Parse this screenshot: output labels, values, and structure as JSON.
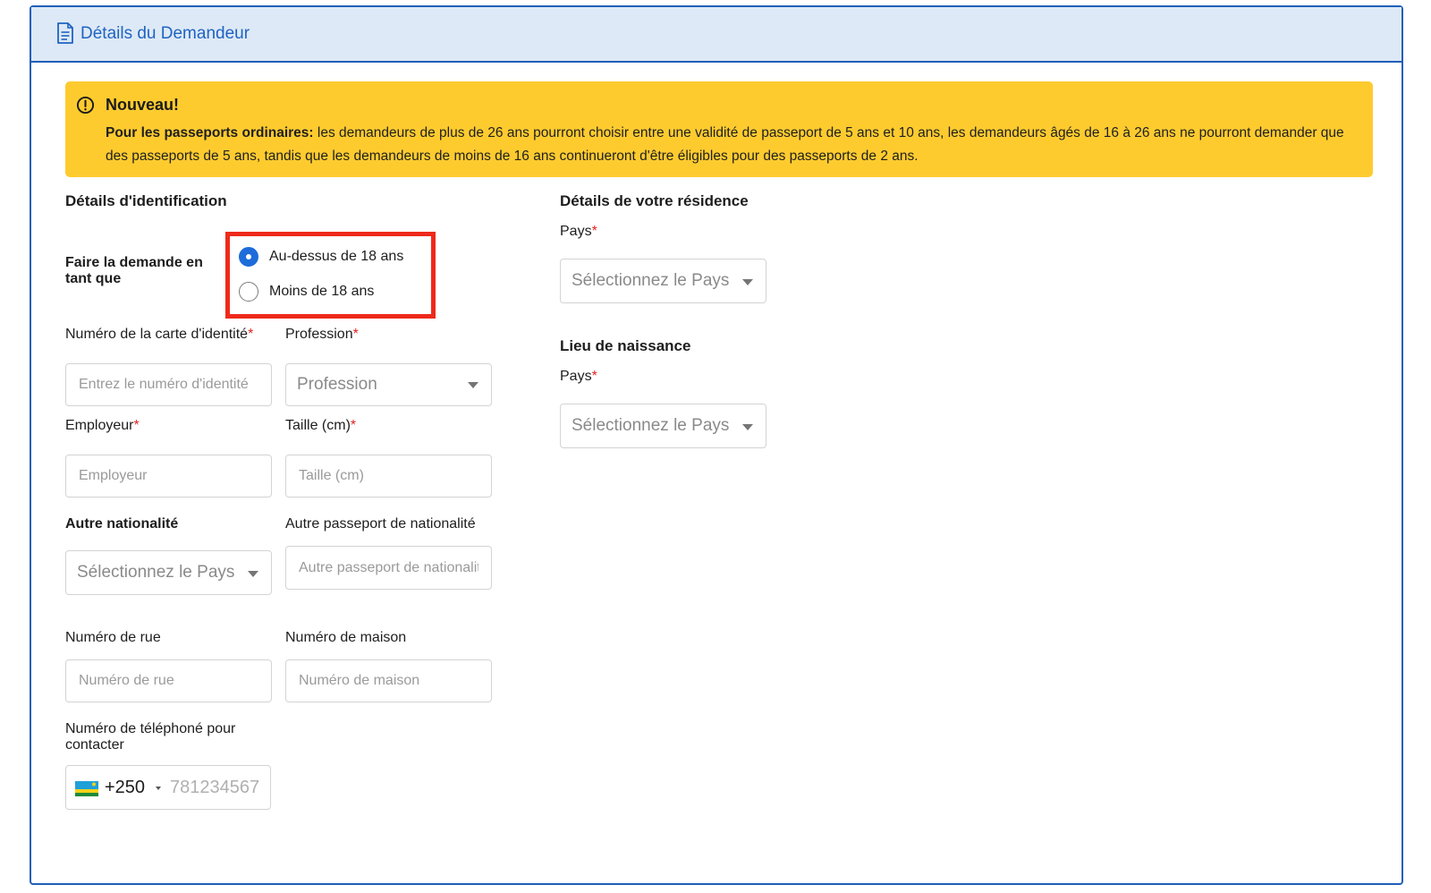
{
  "header": {
    "title": "Détails du Demandeur",
    "icon": "document-icon",
    "accent": "#1f5fb8",
    "background": "#dde9f6"
  },
  "alert": {
    "icon": "exclamation-circle-icon",
    "title": "Nouveau!",
    "bold_lead": "Pour les passeports ordinaires:",
    "text": " les demandeurs de plus de 26 ans pourront choisir entre une validité de passeport de 5 ans et 10 ans, les demandeurs âgés de 16 à 26 ans ne pourront demander que des passeports de 5 ans, tandis que les demandeurs de moins de 16 ans continueront d'être éligibles pour des passeports de 2 ans.",
    "background": "#fecb2f"
  },
  "identification": {
    "title": "Détails d'identification",
    "apply_as_label": "Faire la demande en tant que",
    "options": [
      {
        "label": "Au-dessus de 18 ans",
        "checked": true
      },
      {
        "label": "Moins de 18 ans",
        "checked": false
      }
    ],
    "id_card": {
      "label": "Numéro de la carte d'identité",
      "required": "*",
      "placeholder": "Entrez le numéro d'identité"
    },
    "profession": {
      "label": "Profession",
      "required": "*",
      "placeholder": "Profession"
    },
    "employer": {
      "label": "Employeur",
      "required": "*",
      "placeholder": "Employeur"
    },
    "height": {
      "label": "Taille (cm)",
      "required": "*",
      "placeholder": "Taille (cm)"
    },
    "other_nationality": {
      "label": "Autre nationalité",
      "placeholder": "Sélectionnez le Pays"
    },
    "other_passport": {
      "label": "Autre passeport de nationalité",
      "placeholder": "Autre passeport de nationalité"
    },
    "street": {
      "label": "Numéro de rue",
      "placeholder": "Numéro de rue"
    },
    "house": {
      "label": "Numéro de maison",
      "placeholder": "Numéro de maison"
    },
    "phone": {
      "label": "Numéro de téléphoné pour contacter",
      "dial_code": "+250",
      "placeholder": "781234567",
      "flag": "rwanda-flag-icon"
    }
  },
  "residence": {
    "title": "Détails de votre résidence",
    "country_label": "Pays",
    "required": "*",
    "country_placeholder": "Sélectionnez le Pays"
  },
  "birthplace": {
    "title": "Lieu de naissance",
    "country_label": "Pays",
    "required": "*",
    "country_placeholder": "Sélectionnez le Pays"
  },
  "colors": {
    "highlight_border": "#ee2a1b",
    "radio_checked": "#1d6cd9",
    "required_star": "#e02424"
  }
}
